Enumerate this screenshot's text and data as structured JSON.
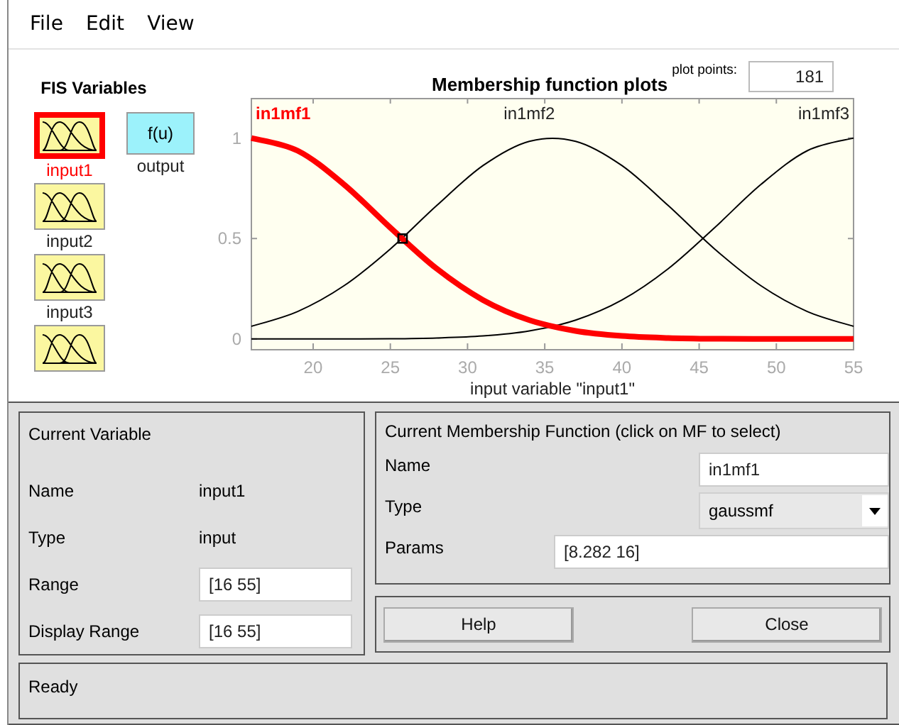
{
  "menu": [
    {
      "label": "File"
    },
    {
      "label": "Edit"
    },
    {
      "label": "View"
    }
  ],
  "fis_variables": {
    "title": "FIS Variables",
    "items": [
      {
        "kind": "input",
        "label": "input1",
        "selected": true
      },
      {
        "kind": "output",
        "symbol": "f(u)",
        "label": "output",
        "selected": false
      },
      {
        "kind": "input",
        "label": "input2",
        "selected": false
      },
      {
        "kind": "input",
        "label": "input3",
        "selected": false
      },
      {
        "kind": "input",
        "selected": false
      }
    ]
  },
  "plot": {
    "curves": [
      {
        "selected": true
      },
      {
        "selected": false
      },
      {
        "selected": false
      }
    ],
    "plot_points_label": "plot points:",
    "plot_points": "181",
    "chart_data": {
      "type": "line",
      "title": "Membership function plots",
      "xlabel": "input variable \"input1\"",
      "x": [
        16,
        19,
        22,
        25,
        28,
        31,
        34,
        37,
        40,
        43,
        46,
        49,
        52,
        55
      ],
      "series": [
        {
          "name": "in1mf1",
          "values": [
            1,
            0.937,
            0.769,
            0.554,
            0.35,
            0.194,
            0.094,
            0.04,
            0.015,
            0.005,
            0.001,
            0,
            0,
            0
          ]
        },
        {
          "name": "in1mf2",
          "values": [
            0.063,
            0.137,
            0.265,
            0.448,
            0.664,
            0.863,
            0.984,
            0.984,
            0.863,
            0.664,
            0.448,
            0.265,
            0.137,
            0.063
          ]
        },
        {
          "name": "in1mf3",
          "values": [
            0,
            0,
            0,
            0.001,
            0.005,
            0.015,
            0.04,
            0.094,
            0.194,
            0.35,
            0.554,
            0.769,
            0.937,
            1
          ]
        }
      ],
      "xlim": [
        16,
        55
      ],
      "ylim": [
        -0.05,
        1.2
      ],
      "xticks": [
        20,
        25,
        30,
        35,
        40,
        45,
        50,
        55
      ],
      "yticks": [
        0,
        0.5,
        1
      ]
    }
  },
  "current_variable": {
    "title": "Current Variable",
    "fields": [
      {
        "kind": "text",
        "label": "Name",
        "value": "input1"
      },
      {
        "kind": "text",
        "label": "Type",
        "value": "input"
      },
      {
        "kind": "input",
        "label": "Range",
        "value": "[16 55]"
      },
      {
        "kind": "input",
        "label": "Display Range",
        "value": "[16 55]"
      }
    ]
  },
  "current_mf": {
    "title": "Current Membership Function (click on MF to select)",
    "name_label": "Name",
    "name": "in1mf1",
    "type_label": "Type",
    "type": "gaussmf",
    "params_label": "Params",
    "params": "[8.282 16]"
  },
  "buttons": [
    {
      "label": "Help"
    },
    {
      "label": "Close"
    }
  ],
  "status_bar": "Ready"
}
